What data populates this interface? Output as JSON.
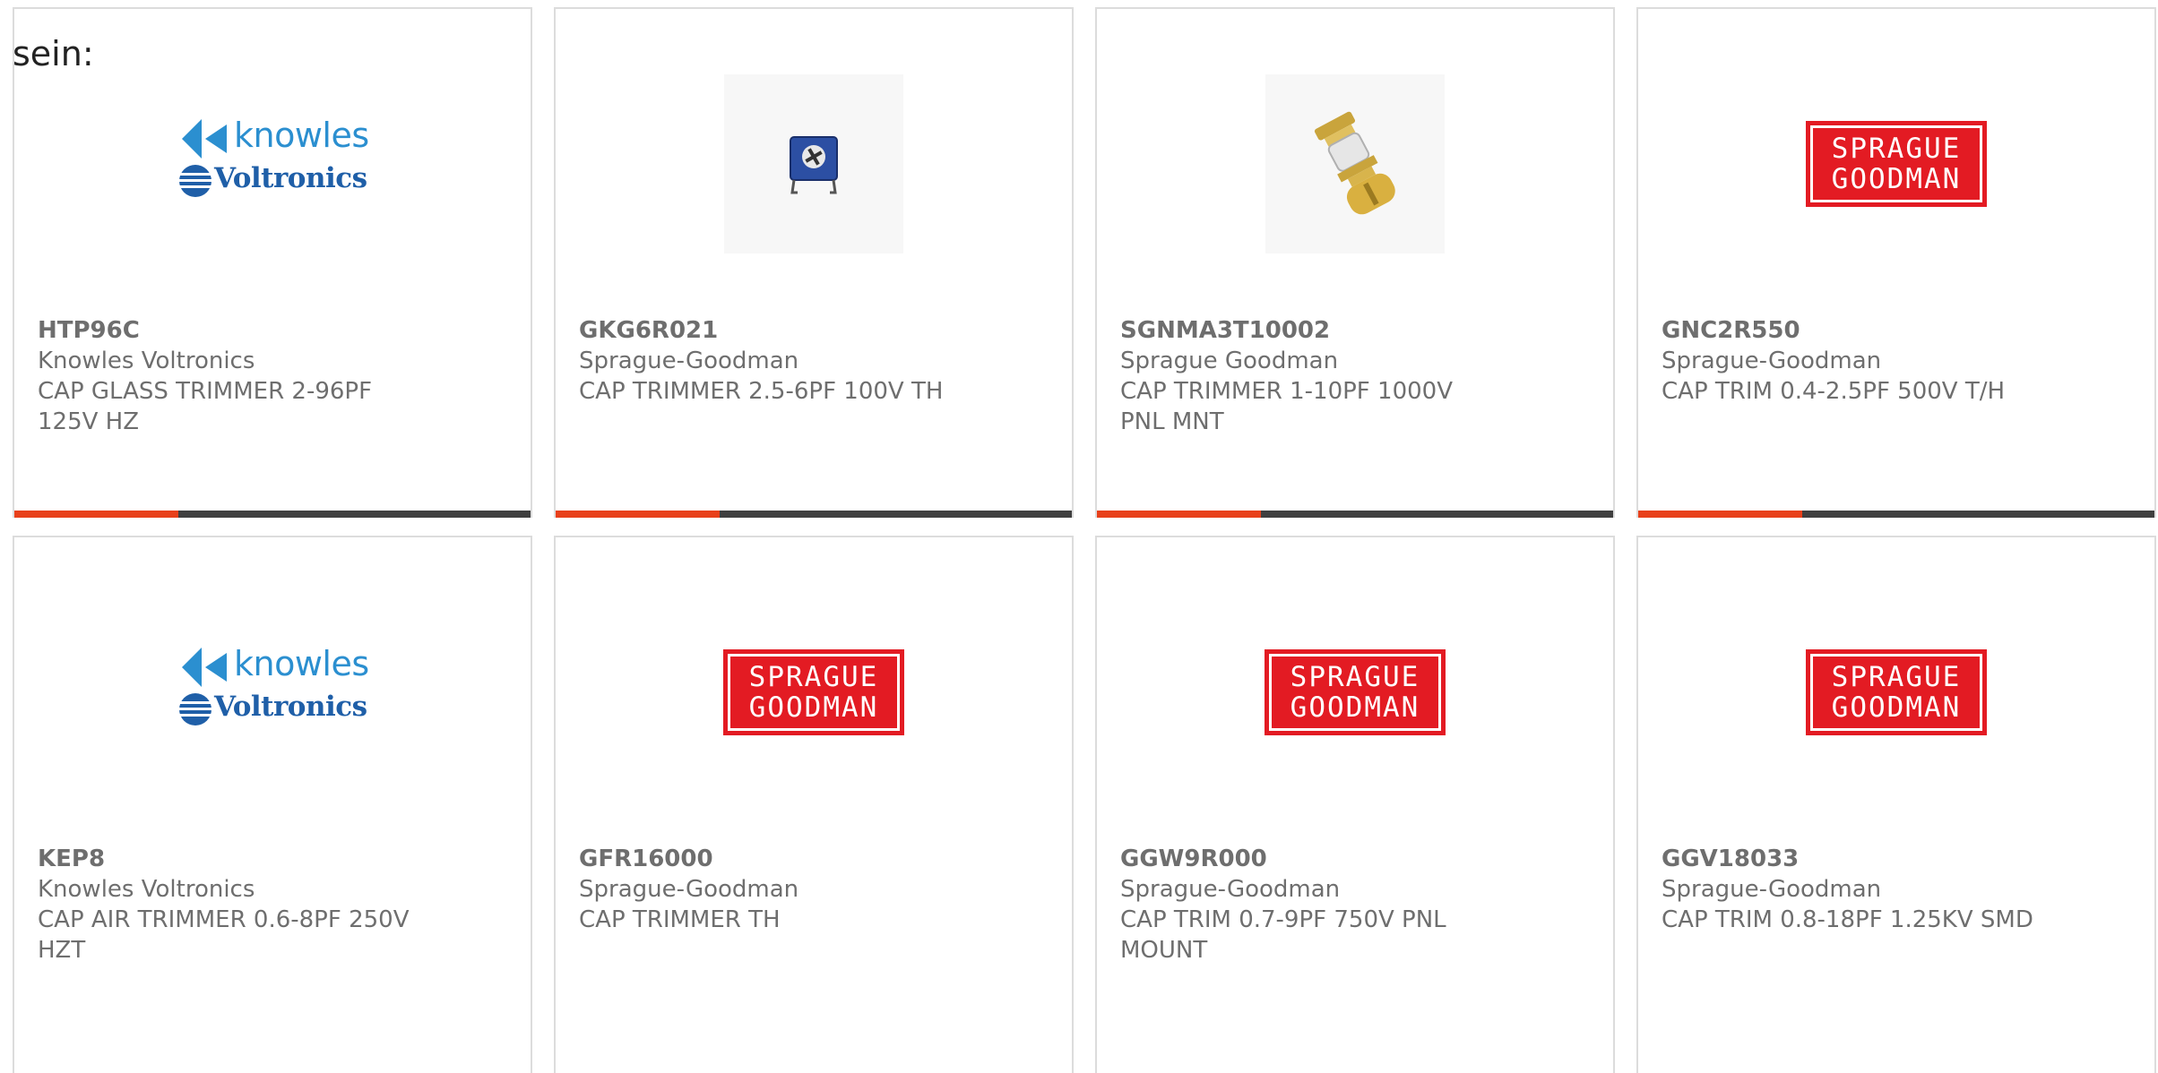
{
  "intro_text": "sein:",
  "colors": {
    "accent": "#e8401a",
    "bar": "#3f3f3f",
    "text": "#6e6e6e",
    "sprague_red": "#e31b23",
    "knowles_blue": "#2b8fd0"
  },
  "logos": {
    "knowles": {
      "line1": "knowles",
      "line2": "Voltronics"
    },
    "sprague": {
      "line1": "SPRAGUE",
      "line2": "GOODMAN"
    }
  },
  "products": [
    {
      "part": "HTP96C",
      "manufacturer": "Knowles Voltronics",
      "description": "CAP GLASS TRIMMER 2-96PF 125V HZ",
      "image": "knowles-logo"
    },
    {
      "part": "GKG6R021",
      "manufacturer": "Sprague-Goodman",
      "description": "CAP TRIMMER 2.5-6PF 100V TH",
      "image": "blue-trimmer-photo"
    },
    {
      "part": "SGNMA3T10002",
      "manufacturer": "Sprague Goodman",
      "description": "CAP TRIMMER 1-10PF 1000V PNL MNT",
      "image": "brass-trimmer-photo"
    },
    {
      "part": "GNC2R550",
      "manufacturer": "Sprague-Goodman",
      "description": "CAP TRIM 0.4-2.5PF 500V T/H",
      "image": "sprague-logo"
    },
    {
      "part": "KEP8",
      "manufacturer": "Knowles Voltronics",
      "description": "CAP AIR TRIMMER 0.6-8PF 250V HZT",
      "image": "knowles-logo"
    },
    {
      "part": "GFR16000",
      "manufacturer": "Sprague-Goodman",
      "description": "CAP TRIMMER TH",
      "image": "sprague-logo"
    },
    {
      "part": "GGW9R000",
      "manufacturer": "Sprague-Goodman",
      "description": "CAP TRIM 0.7-9PF 750V PNL MOUNT",
      "image": "sprague-logo"
    },
    {
      "part": "GGV18033",
      "manufacturer": "Sprague-Goodman",
      "description": "CAP TRIM 0.8-18PF 1.25KV SMD",
      "image": "sprague-logo"
    }
  ]
}
